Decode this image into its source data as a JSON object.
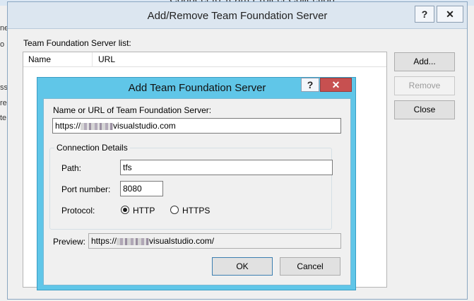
{
  "background": {
    "title_fragment": "Connect to Team Project Collection",
    "edge_texts": [
      "ne",
      "o",
      "ss",
      "re",
      "te"
    ]
  },
  "add_remove": {
    "title": "Add/Remove Team Foundation Server",
    "help_label": "?",
    "close_label": "✕",
    "list_label": "Team Foundation Server list:",
    "columns": [
      "Name",
      "URL"
    ],
    "buttons": {
      "add": "Add...",
      "remove": "Remove",
      "close": "Close"
    }
  },
  "add_dialog": {
    "title": "Add Team Foundation Server",
    "help_label": "?",
    "close_label": "✕",
    "name_label": "Name or URL of Team Foundation Server:",
    "name_value_prefix": "https://",
    "name_value_suffix": "visualstudio.com",
    "group_title": "Connection Details",
    "path_label": "Path:",
    "path_value": "tfs",
    "port_label": "Port number:",
    "port_value": "8080",
    "protocol_label": "Protocol:",
    "protocol_options": [
      "HTTP",
      "HTTPS"
    ],
    "protocol_selected": "HTTP",
    "preview_label": "Preview:",
    "preview_prefix": "https://",
    "preview_suffix": "visualstudio.com/",
    "ok_label": "OK",
    "cancel_label": "Cancel"
  },
  "colors": {
    "dialog_accent": "#60c6e8",
    "close_red": "#c75050"
  }
}
